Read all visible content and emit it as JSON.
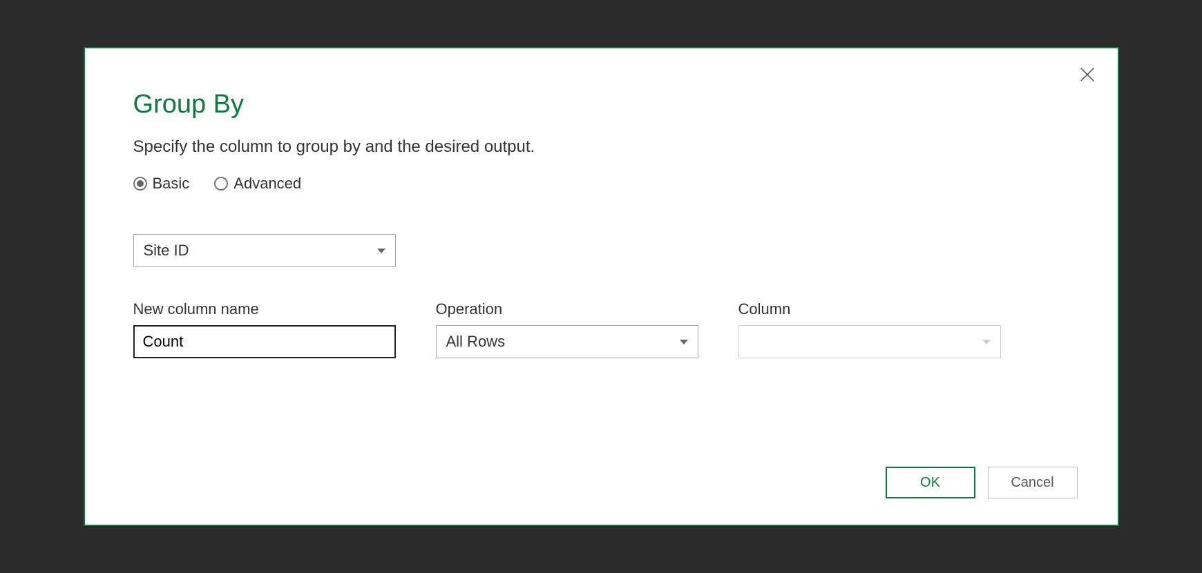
{
  "dialog": {
    "title": "Group By",
    "subtitle": "Specify the column to group by and the desired output."
  },
  "mode": {
    "basic_label": "Basic",
    "advanced_label": "Advanced",
    "selected": "basic"
  },
  "group_by_column": {
    "value": "Site ID"
  },
  "fields": {
    "new_column_name_label": "New column name",
    "new_column_name_value": "Count",
    "operation_label": "Operation",
    "operation_value": "All Rows",
    "column_label": "Column",
    "column_value": ""
  },
  "buttons": {
    "ok_label": "OK",
    "cancel_label": "Cancel"
  }
}
